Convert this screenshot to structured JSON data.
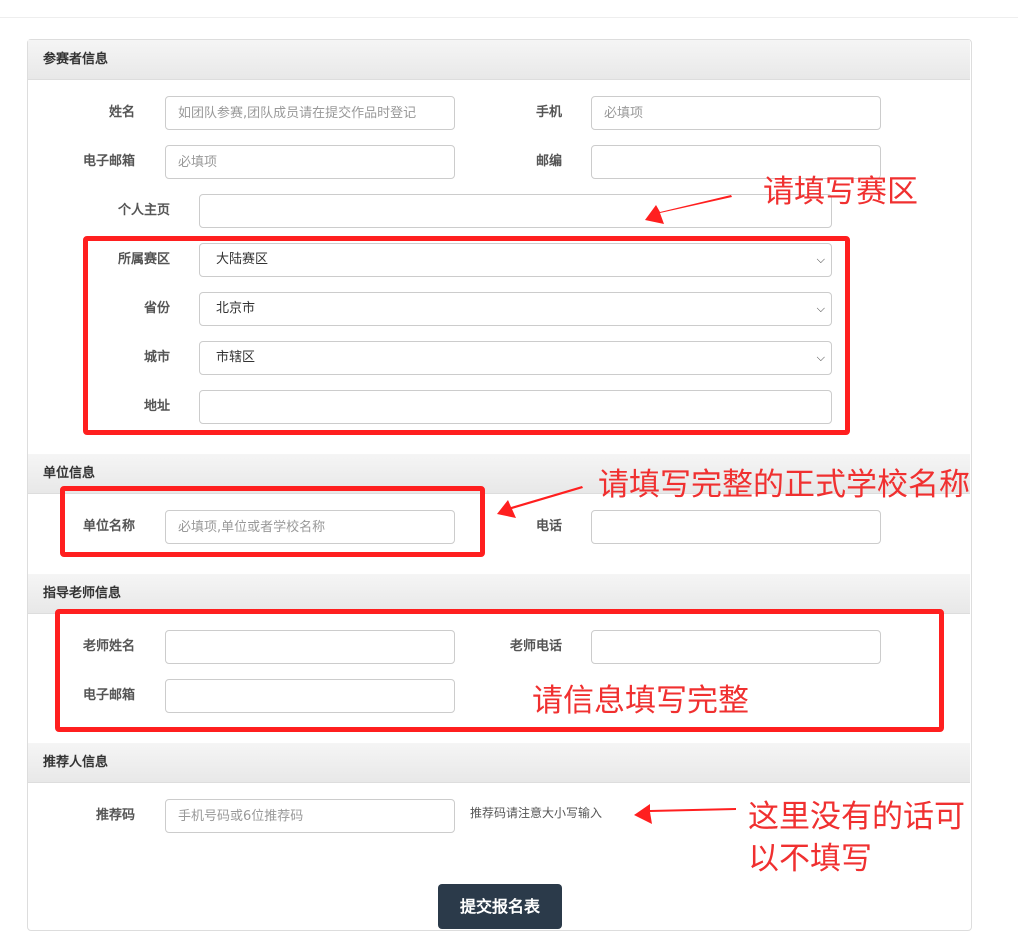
{
  "sections": {
    "participant": "参赛者信息",
    "unit": "单位信息",
    "teacher": "指导老师信息",
    "referrer": "推荐人信息"
  },
  "participant": {
    "name_label": "姓名",
    "name_placeholder": "如团队参赛,团队成员请在提交作品时登记",
    "phone_label": "手机",
    "phone_placeholder": "必填项",
    "email_label": "电子邮箱",
    "email_placeholder": "必填项",
    "zip_label": "邮编",
    "homepage_label": "个人主页",
    "region_label": "所属赛区",
    "region_value": "大陆赛区",
    "province_label": "省份",
    "province_value": "北京市",
    "city_label": "城市",
    "city_value": "市辖区",
    "address_label": "地址"
  },
  "unit": {
    "name_label": "单位名称",
    "name_placeholder": "必填项,单位或者学校名称",
    "phone_label": "电话"
  },
  "teacher": {
    "name_label": "老师姓名",
    "phone_label": "老师电话",
    "email_label": "电子邮箱"
  },
  "referrer": {
    "code_label": "推荐码",
    "code_placeholder": "手机号码或6位推荐码",
    "hint": "推荐码请注意大小写输入"
  },
  "submit_label": "提交报名表",
  "annotations": {
    "region_note": "请填写赛区",
    "school_note": "请填写完整的正式学校名称",
    "teacher_note": "请信息填写完整",
    "referrer_note_line1": "这里没有的话可",
    "referrer_note_line2": "以不填写"
  },
  "colors": {
    "annotation_red": "#ff1f1f",
    "button_bg": "#2b3a4a"
  }
}
